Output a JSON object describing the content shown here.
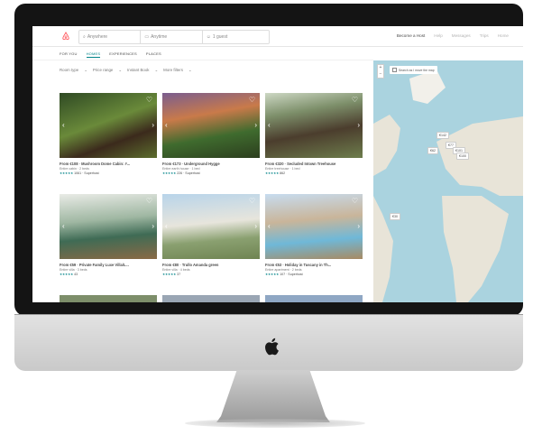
{
  "site": {
    "search": {
      "where": "Anywhere",
      "when": "Anytime",
      "guests": "1 guest"
    },
    "nav": [
      "Become a Host",
      "Help",
      "Messages",
      "Trips",
      "Home"
    ],
    "tabs": [
      "FOR YOU",
      "HOMES",
      "EXPERIENCES",
      "PLACES"
    ],
    "active_tab": "HOMES",
    "filters": [
      "Room type",
      "Price range",
      "Instant Book",
      "More filters"
    ],
    "map": {
      "search_as_move": "Search as I move the map",
      "zoom_in": "+",
      "zoom_out": "−",
      "pins": [
        "€142",
        "€77",
        "€101",
        "€62",
        "€100",
        "€30"
      ]
    }
  },
  "listings": [
    {
      "title": "From €108 · Mushroom Dome Cabin: #...",
      "sub": "Entire cabin · 2 beds",
      "stars": "★★★★★",
      "reviews": "1061 · Superhost"
    },
    {
      "title": "From €173 · Underground Hygge",
      "sub": "Entire earth house · 1 bed",
      "stars": "★★★★★",
      "reviews": "226 · Superhost"
    },
    {
      "title": "From €320 · Secluded Intown Treehouse",
      "sub": "Entire treehouse · 1 bed",
      "stars": "★★★★★",
      "reviews": "862"
    },
    {
      "title": "From €59 · Private Family Luxe Villa/L...",
      "sub": "Entire villa · 3 beds",
      "stars": "★★★★★",
      "reviews": "43"
    },
    {
      "title": "From €80 · Trullo Amanda green",
      "sub": "Entire villa · 4 beds",
      "stars": "★★★★★",
      "reviews": "37"
    },
    {
      "title": "From €53 · Holiday in Tuscany in Th...",
      "sub": "Entire apartment · 2 beds",
      "stars": "★★★★★",
      "reviews": "107 · Superhost"
    }
  ],
  "colors": {
    "brand": "#ff5a5f",
    "accent": "#008489",
    "map_water": "#aad3df",
    "map_land": "#e8e4d8"
  }
}
